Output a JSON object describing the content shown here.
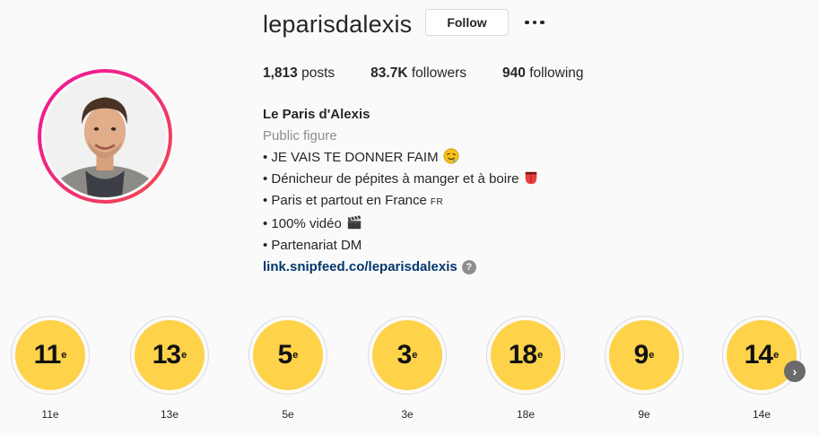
{
  "profile": {
    "username": "leparisdalexis",
    "follow_label": "Follow",
    "more_icon": "more-horizontal-icon"
  },
  "stats": {
    "posts_count": "1,813",
    "posts_label": "posts",
    "followers_count": "83.7K",
    "followers_label": "followers",
    "following_count": "940",
    "following_label": "following"
  },
  "bio": {
    "name": "Le Paris d'Alexis",
    "category": "Public figure",
    "lines": [
      "• JE VAIS TE DONNER FAIM",
      "• Dénicheur de pépites à manger et à boire",
      "• Paris et partout en France",
      "• 100% vidéo",
      "• Partenariat DM"
    ],
    "flag_text": "FR",
    "link": "link.snipfeed.co/leparisdalexis",
    "help_symbol": "?"
  },
  "highlights": [
    {
      "num": "11",
      "sup": "e",
      "label": "11e"
    },
    {
      "num": "13",
      "sup": "e",
      "label": "13e"
    },
    {
      "num": "5",
      "sup": "e",
      "label": "5e"
    },
    {
      "num": "3",
      "sup": "e",
      "label": "3e"
    },
    {
      "num": "18",
      "sup": "e",
      "label": "18e"
    },
    {
      "num": "9",
      "sup": "e",
      "label": "9e"
    },
    {
      "num": "14",
      "sup": "e",
      "label": "14e"
    }
  ],
  "colors": {
    "highlight_fill": "#fed249",
    "link": "#00376b",
    "ring_gradient_start": "#f2139c",
    "ring_gradient_end": "#f34b4b"
  }
}
